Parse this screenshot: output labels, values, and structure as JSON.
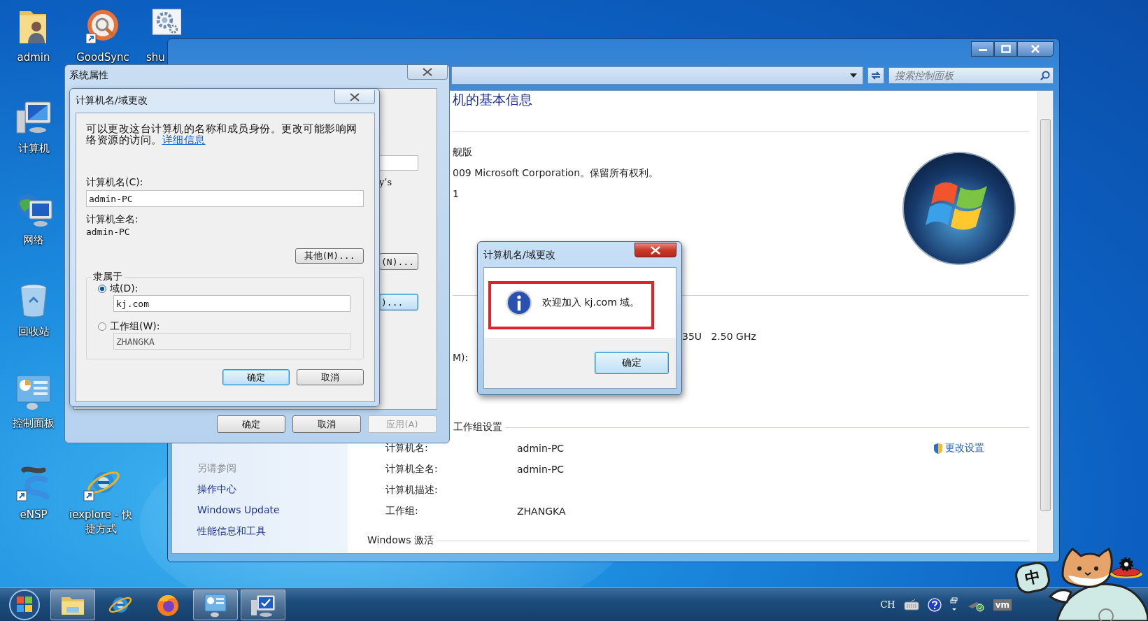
{
  "desktop_icons": [
    {
      "label": "admin",
      "kind": "user-folder"
    },
    {
      "label": "GoodSync",
      "kind": "goodsync"
    },
    {
      "label": "shu",
      "kind": "gear"
    },
    {
      "label": "计算机",
      "kind": "computer"
    },
    {
      "label": "网络",
      "kind": "network"
    },
    {
      "label": "回收站",
      "kind": "recycle"
    },
    {
      "label": "控制面板",
      "kind": "control-panel"
    },
    {
      "label": "eNSP",
      "kind": "ensp"
    },
    {
      "label": "iexplore - 快捷方式",
      "kind": "ie"
    }
  ],
  "control_panel": {
    "search": {
      "placeholder": "搜索控制面板"
    },
    "heading": "机的基本信息",
    "edition": "舰版",
    "copyright": "009 Microsoft Corporation。保留所有权利。",
    "service_pack": "1",
    "processor": "35U   2.50 GHz",
    "pen_label": "M):",
    "workgroup_heading": "工作组设置",
    "settings": [
      {
        "label": "计算机名:",
        "value": "admin-PC"
      },
      {
        "label": "计算机全名:",
        "value": "admin-PC"
      },
      {
        "label": "计算机描述:"
      },
      {
        "label": "工作组:",
        "value": "ZHANGKA"
      }
    ],
    "change_settings": "更改设置",
    "activation_heading": "Windows 激活",
    "see_also": {
      "title": "另请参阅",
      "links": [
        "操作中心",
        "Windows Update",
        "性能信息和工具"
      ]
    }
  },
  "system_properties": {
    "title": "系统属性",
    "text_fragment": "y’s",
    "side_buttons": [
      {
        "label": "(N)...",
        "default": false
      },
      {
        "label": ")...",
        "default": true
      }
    ],
    "buttons": [
      {
        "label": "确定",
        "disabled": false
      },
      {
        "label": "取消",
        "disabled": false
      },
      {
        "label": "应用(A)",
        "disabled": true
      }
    ]
  },
  "name_dialog": {
    "title": "计算机名/域更改",
    "description": "可以更改这台计算机的名称和成员身份。更改可能影响网络资源的访问。",
    "details_link": "详细信息",
    "name_label": "计算机名(C):",
    "name_value": "admin-PC",
    "full_name_label": "计算机全名:",
    "full_name": "admin-PC",
    "more_button": "其他(M)...",
    "member_of": "隶属于",
    "options": [
      {
        "label": "域(D):",
        "value": "kj.com",
        "selected": true
      },
      {
        "label": "工作组(W):",
        "value": "ZHANGKA",
        "selected": false
      }
    ],
    "buttons": [
      {
        "label": "确定",
        "default": true
      },
      {
        "label": "取消",
        "default": false
      }
    ]
  },
  "message_box": {
    "title": "计算机名/域更改",
    "message": "欢迎加入 kj.com 域。",
    "highlighted": true,
    "button": "确定"
  },
  "taskbar": {
    "items": [
      {
        "kind": "explorer",
        "active": true
      },
      {
        "kind": "ie",
        "active": false
      },
      {
        "kind": "firefox",
        "active": false
      },
      {
        "kind": "control-panel",
        "active": true
      },
      {
        "kind": "system",
        "active": true
      }
    ],
    "tray": {
      "language": "CH",
      "vm_label": "vm"
    },
    "ime_badge": "中"
  }
}
